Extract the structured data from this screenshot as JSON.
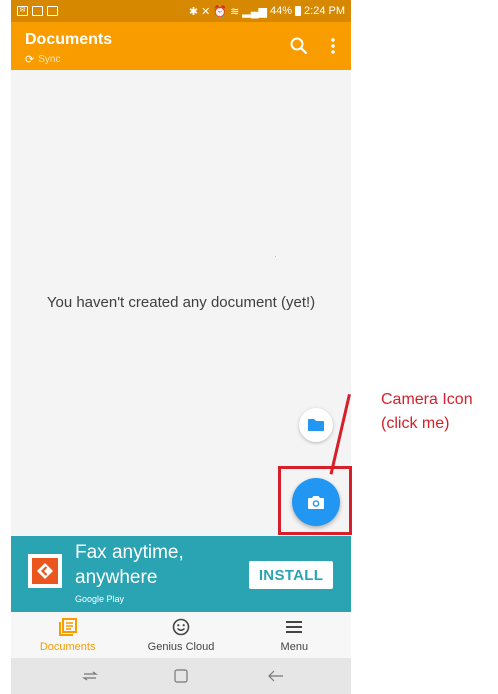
{
  "status_bar": {
    "time": "2:24 PM",
    "battery": "44%",
    "left_icons": [
      "mail-icon",
      "app-icon",
      "app-icon"
    ],
    "right_icons": [
      "bluetooth-icon",
      "mute-icon",
      "alarm-icon",
      "wifi-icon",
      "signal-icon",
      "battery-icon"
    ]
  },
  "app_bar": {
    "title": "Documents",
    "sync_label": "Sync",
    "icons": [
      "search-icon",
      "more-vert-icon"
    ]
  },
  "content": {
    "empty_message": "You haven't created any document (yet!)"
  },
  "fabs": {
    "folder": "folder-icon",
    "camera": "camera-icon"
  },
  "ad": {
    "line1": "Fax anytime,",
    "line2": "anywhere",
    "store": "Google Play",
    "install_label": "INSTALL"
  },
  "bottom_nav": {
    "items": [
      {
        "label": "Documents",
        "icon": "documents-icon",
        "active": true
      },
      {
        "label": "Genius Cloud",
        "icon": "smiley-icon",
        "active": false
      },
      {
        "label": "Menu",
        "icon": "hamburger-icon",
        "active": false
      }
    ]
  },
  "annotation": {
    "line1": "Camera Icon",
    "line2": "(click me)"
  },
  "colors": {
    "app_bar": "#f99c00",
    "status_bar": "#d58800",
    "fab": "#2196f3",
    "ad": "#2aa3b3",
    "annotation": "#d61f2b"
  }
}
